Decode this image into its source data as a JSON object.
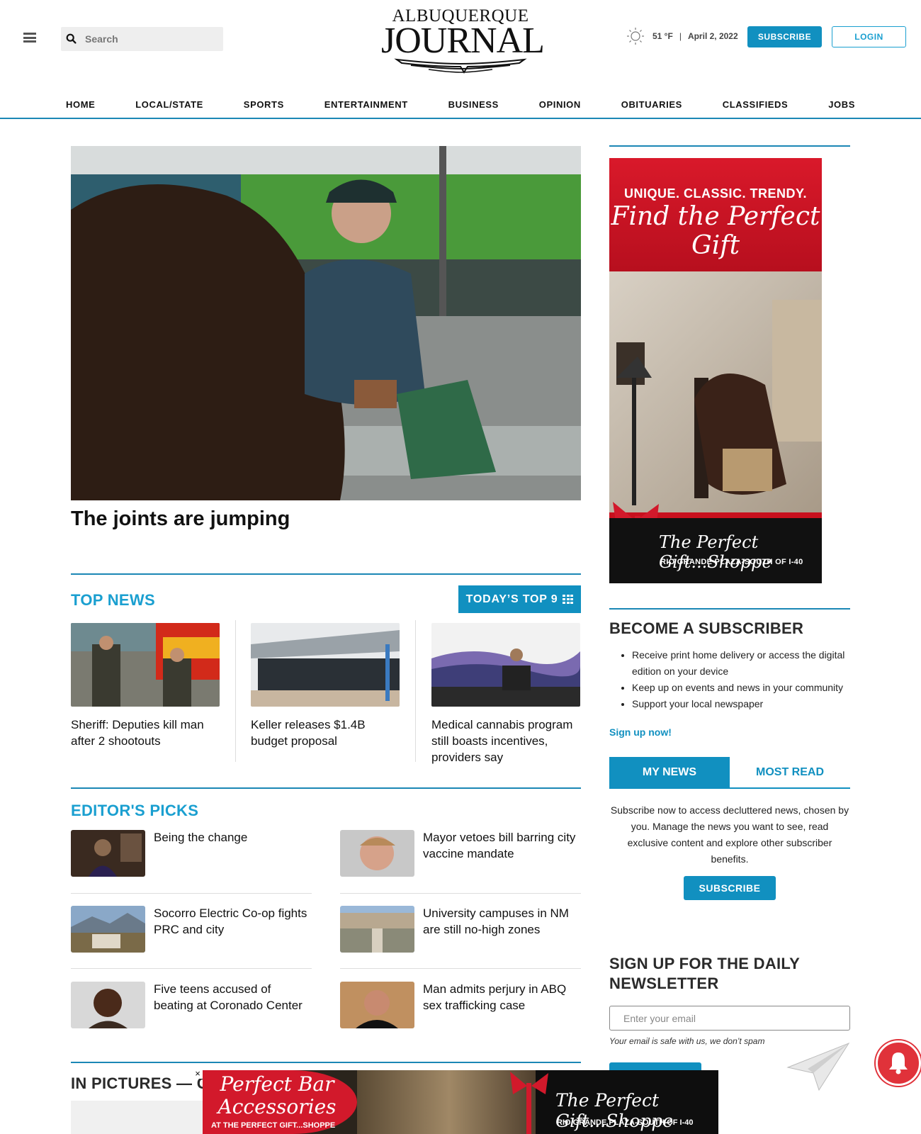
{
  "header": {
    "search_placeholder": "Search",
    "logo_line1": "ALBUQUERQUE",
    "logo_line2": "JOURNAL",
    "weather_temp": "51 °F",
    "weather_separator": "|",
    "date": "April 2, 2022",
    "subscribe_label": "SUBSCRIBE",
    "login_label": "LOGIN",
    "weather_icon": "sun-icon"
  },
  "nav": {
    "items": [
      "HOME",
      "LOCAL/STATE",
      "SPORTS",
      "ENTERTAINMENT",
      "BUSINESS",
      "OPINION",
      "OBITUARIES",
      "CLASSIFIEDS",
      "JOBS"
    ]
  },
  "hero": {
    "title": "The joints are jumping"
  },
  "top_news": {
    "title": "TOP NEWS",
    "today_top_label": "TODAY’S TOP 9",
    "stories": [
      {
        "caption": "Sheriff: Deputies kill man after 2 shootouts"
      },
      {
        "caption": "Keller releases $1.4B budget proposal"
      },
      {
        "caption": "Medical cannabis program still boasts incentives, providers say"
      }
    ]
  },
  "editors_picks": {
    "title": "EDITOR'S PICKS",
    "items": [
      {
        "caption": "Being the change"
      },
      {
        "caption": "Mayor vetoes bill barring city vaccine mandate"
      },
      {
        "caption": "Socorro Electric Co-op fights PRC and city"
      },
      {
        "caption": "University campuses in NM are still no-high zones"
      },
      {
        "caption": "Five teens accused of beating at Coronado Center"
      },
      {
        "caption": "Man admits perjury in ABQ sex trafficking case"
      }
    ]
  },
  "in_pictures": {
    "title": "IN PICTURES — C"
  },
  "side_ad": {
    "line1": "UNIQUE. CLASSIC. TRENDY.",
    "line2": "Find the Perfect Gift",
    "brand": "The Perfect Gift...Shoppe",
    "location": "RIO GRANDE PLAZA-SOUTH OF I-40"
  },
  "subscriber": {
    "title": "BECOME A SUBSCRIBER",
    "benefits": [
      "Receive print home delivery or access the digital edition on your device",
      "Keep up on events and news in your community",
      "Support your local newspaper"
    ],
    "signup_link": "Sign up now!"
  },
  "news_tabs": {
    "active": "MY NEWS",
    "inactive": "MOST READ",
    "text": "Subscribe now to access decluttered news, chosen by you. Manage the news you want to see, read exclusive content and explore other subscriber benefits.",
    "subscribe_label": "SUBSCRIBE"
  },
  "newsletter": {
    "title": "SIGN UP FOR THE DAILY NEWSLETTER",
    "email_placeholder": "Enter your email",
    "note": "Your email is safe with us, we don’t spam"
  },
  "bottom_ad": {
    "left_line": "Perfect Bar Accessories",
    "left_sub": "AT THE PERFECT GIFT...SHOPPE",
    "brand": "The Perfect Gift...Shoppe",
    "location": "RIO GRANDE PLAZA-SOUTH OF I-40",
    "close": "×"
  },
  "colors": {
    "accent": "#1190c0",
    "section_rule": "#1b87b5",
    "ad_red": "#d2192b",
    "notification": "#e0323a"
  }
}
